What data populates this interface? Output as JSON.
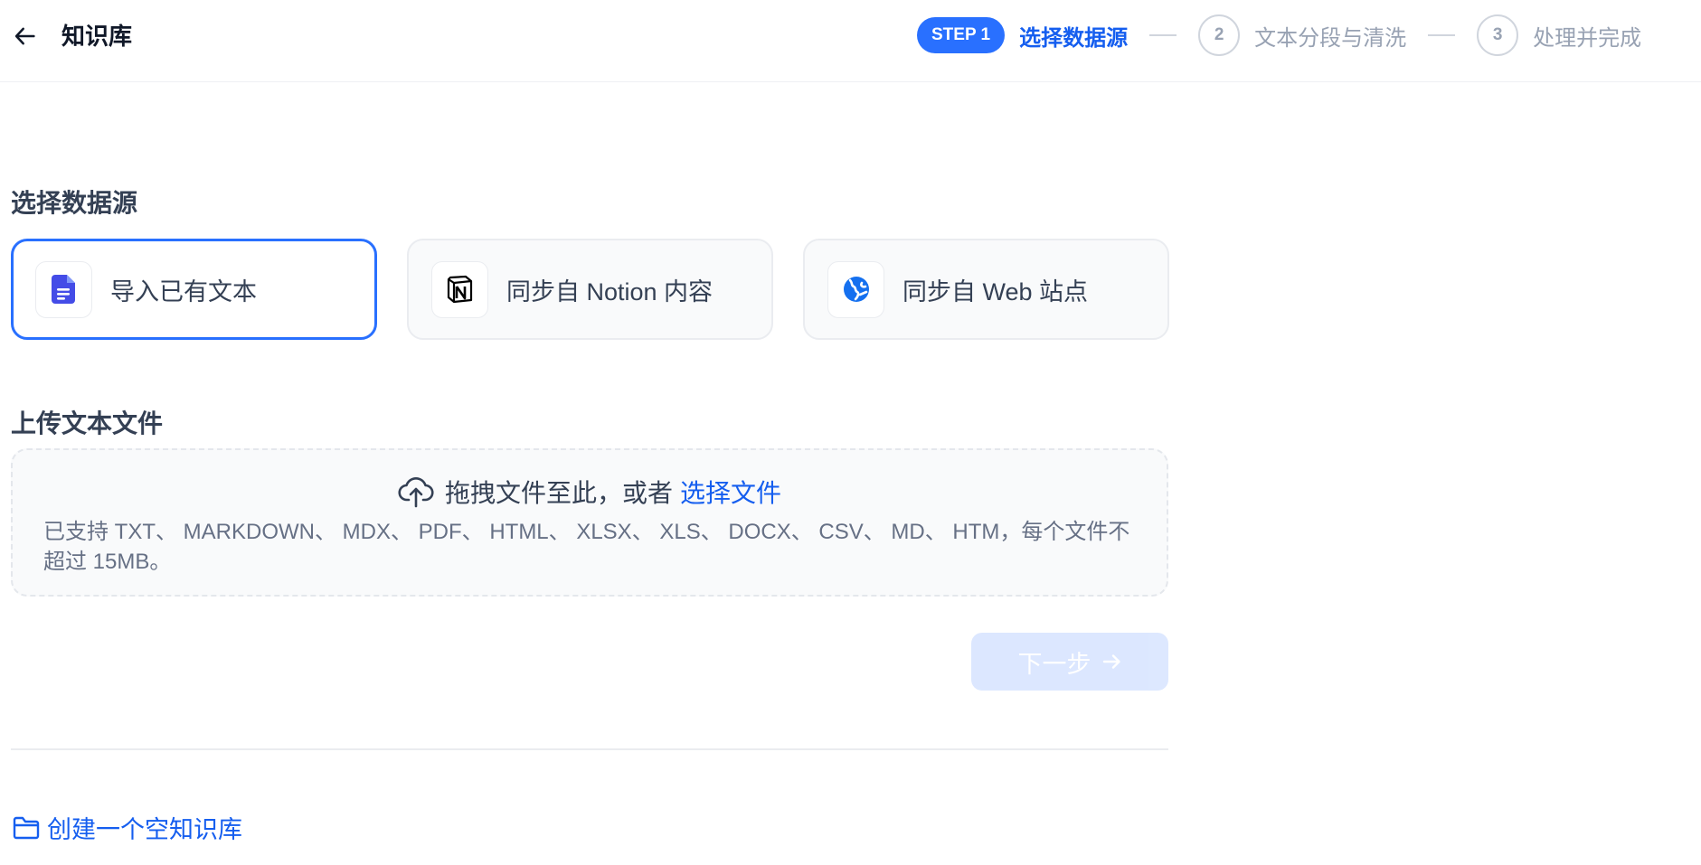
{
  "header": {
    "back_icon": "arrow-left-icon",
    "title": "知识库"
  },
  "steps": [
    {
      "badge": "STEP 1",
      "label": "选择数据源",
      "state": "active"
    },
    {
      "badge": "2",
      "label": "文本分段与清洗",
      "state": "inactive"
    },
    {
      "badge": "3",
      "label": "处理并完成",
      "state": "inactive"
    }
  ],
  "data_source": {
    "title": "选择数据源",
    "options": [
      {
        "label": "导入已有文本",
        "icon": "document-icon",
        "selected": true
      },
      {
        "label": "同步自 Notion 内容",
        "icon": "notion-icon",
        "selected": false
      },
      {
        "label": "同步自 Web 站点",
        "icon": "web-globe-icon",
        "selected": false
      }
    ]
  },
  "upload": {
    "title": "上传文本文件",
    "drag_text": "拖拽文件至此，或者",
    "select_link": "选择文件",
    "hint": "已支持 TXT、 MARKDOWN、 MDX、 PDF、 HTML、 XLSX、 XLS、 DOCX、 CSV、 MD、 HTM，每个文件不超过 15MB。",
    "icon": "cloud-upload-icon"
  },
  "next_button": {
    "label": "下一步",
    "enabled": false
  },
  "create_empty": {
    "label": "创建一个空知识库",
    "icon": "folder-icon"
  },
  "colors": {
    "primary": "#155eef",
    "primary_pill": "#2970ff",
    "disabled_button": "#d1e0ff"
  }
}
